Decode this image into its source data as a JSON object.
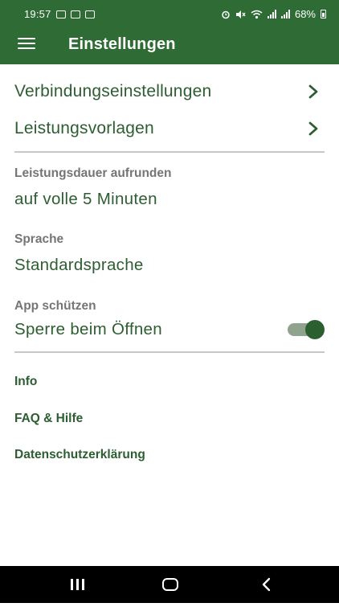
{
  "status_bar": {
    "time": "19:57",
    "battery": "68%",
    "icons_left": [
      "teams-icon",
      "calendar-icon",
      "gallery-icon"
    ],
    "icons_right": [
      "alarm-icon",
      "mute-icon",
      "wifi-icon",
      "signal-icon",
      "signal-icon",
      "battery-icon"
    ]
  },
  "app_bar": {
    "title": "Einstellungen",
    "menu_icon": "hamburger-menu-icon"
  },
  "nav_items": [
    {
      "label": "Verbindungseinstellungen"
    },
    {
      "label": "Leistungsvorlagen"
    }
  ],
  "settings": {
    "rounding": {
      "label": "Leistungsdauer aufrunden",
      "value": "auf volle 5 Minuten"
    },
    "language": {
      "label": "Sprache",
      "value": "Standardsprache"
    },
    "protect": {
      "label": "App schützen",
      "value": "Sperre beim Öffnen",
      "enabled": true
    }
  },
  "links": [
    "Info",
    "FAQ & Hilfe",
    "Datenschutzerklärung"
  ],
  "colors": {
    "primary": "#2f6b34",
    "text_green": "#2d5e31",
    "label_gray": "#757575",
    "divider": "#c8c8c8"
  }
}
